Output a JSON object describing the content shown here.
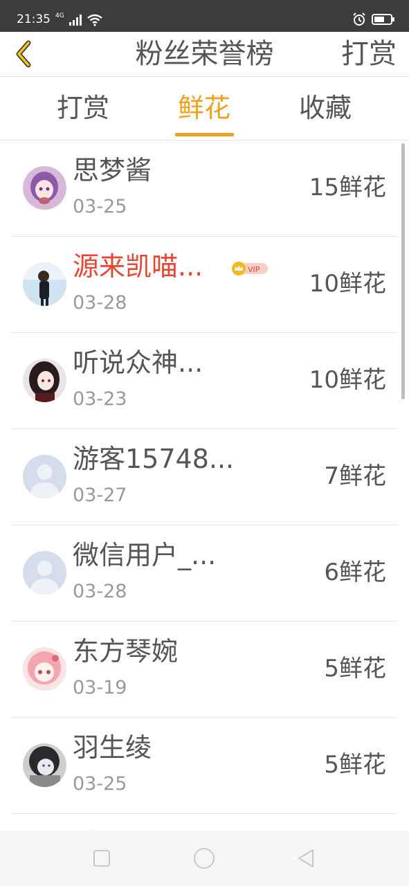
{
  "status_bar": {
    "time": "21:35",
    "network": "4G"
  },
  "header": {
    "title": "粉丝荣誉榜",
    "action_label": "打赏"
  },
  "tabs": [
    {
      "label": "打赏",
      "active": false
    },
    {
      "label": "鲜花",
      "active": true
    },
    {
      "label": "收藏",
      "active": false
    }
  ],
  "colors": {
    "accent": "#f0a020",
    "vip_name": "#e8462e",
    "text": "#555555",
    "muted": "#999999"
  },
  "fans": [
    {
      "name": "思梦酱",
      "date": "03-25",
      "count": "15鲜花",
      "vip": false
    },
    {
      "name": "源来凯喵...",
      "date": "03-28",
      "count": "10鲜花",
      "vip": true
    },
    {
      "name": "听说众神...",
      "date": "03-23",
      "count": "10鲜花",
      "vip": false
    },
    {
      "name": "游客15748...",
      "date": "03-27",
      "count": "7鲜花",
      "vip": false
    },
    {
      "name": "微信用户_...",
      "date": "03-28",
      "count": "6鲜花",
      "vip": false
    },
    {
      "name": "东方琴婉",
      "date": "03-19",
      "count": "5鲜花",
      "vip": false
    },
    {
      "name": "羽生绫",
      "date": "03-25",
      "count": "5鲜花",
      "vip": false
    },
    {
      "name": "秋凉",
      "date": "",
      "count": "",
      "vip": false
    }
  ],
  "vip_badge_text": "VIP"
}
